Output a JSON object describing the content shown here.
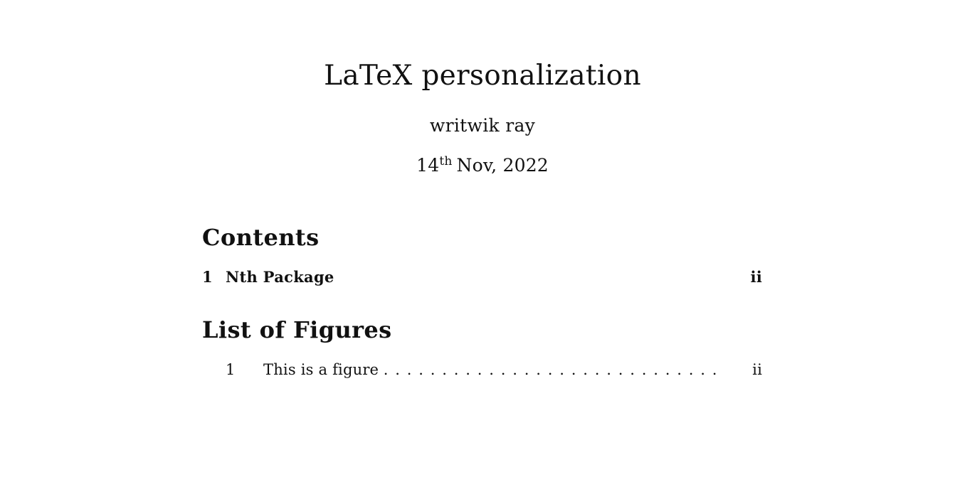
{
  "document": {
    "title": "LaTeX personalization",
    "author": "writwik ray",
    "date": {
      "day": "14",
      "suffix": "th",
      "rest": "Nov, 2022"
    }
  },
  "contents": {
    "heading": "Contents",
    "entries": [
      {
        "number": "1",
        "label": "Nth Package",
        "page": "ii"
      }
    ]
  },
  "list_of_figures": {
    "heading": "List of Figures",
    "entries": [
      {
        "number": "1",
        "label": "This is a figure",
        "page": "ii"
      }
    ]
  }
}
